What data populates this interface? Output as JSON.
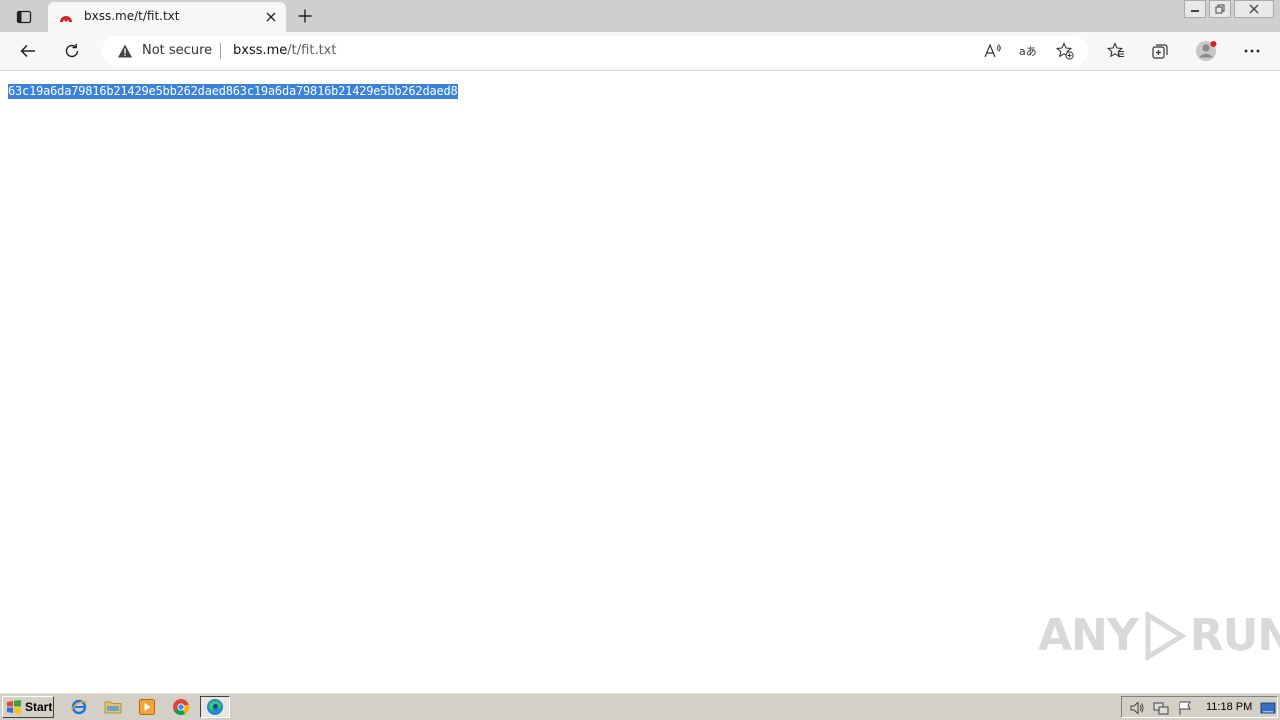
{
  "tab": {
    "title": "bxss.me/t/fit.txt"
  },
  "address_bar": {
    "security_label": "Not secure",
    "host": "bxss.me",
    "path": "/t/fit.txt"
  },
  "page": {
    "content_text": "63c19a6da79816b21429e5bb262daed863c19a6da79816b21429e5bb262daed8",
    "selected": true
  },
  "watermark": {
    "left": "ANY",
    "right": "RUN"
  },
  "taskbar": {
    "start_label": "Start",
    "clock": "11:18 PM"
  },
  "colors": {
    "selection": "#3b82dd",
    "favicon": "#d4202a",
    "taskbar": "#d4d0c8"
  },
  "icons": {
    "tab_actions": "tab-actions-icon",
    "favicon": "bxss-favicon-icon",
    "close_tab": "close-icon",
    "new_tab": "plus-icon",
    "back": "back-arrow-icon",
    "refresh": "refresh-icon",
    "warning": "warning-triangle-icon",
    "read_aloud": "read-aloud-icon",
    "translate": "translate-icon",
    "add_favorite": "star-plus-icon",
    "favorites": "favorites-icon",
    "collections": "collections-icon",
    "profile": "profile-avatar-icon",
    "more": "more-dots-icon"
  }
}
